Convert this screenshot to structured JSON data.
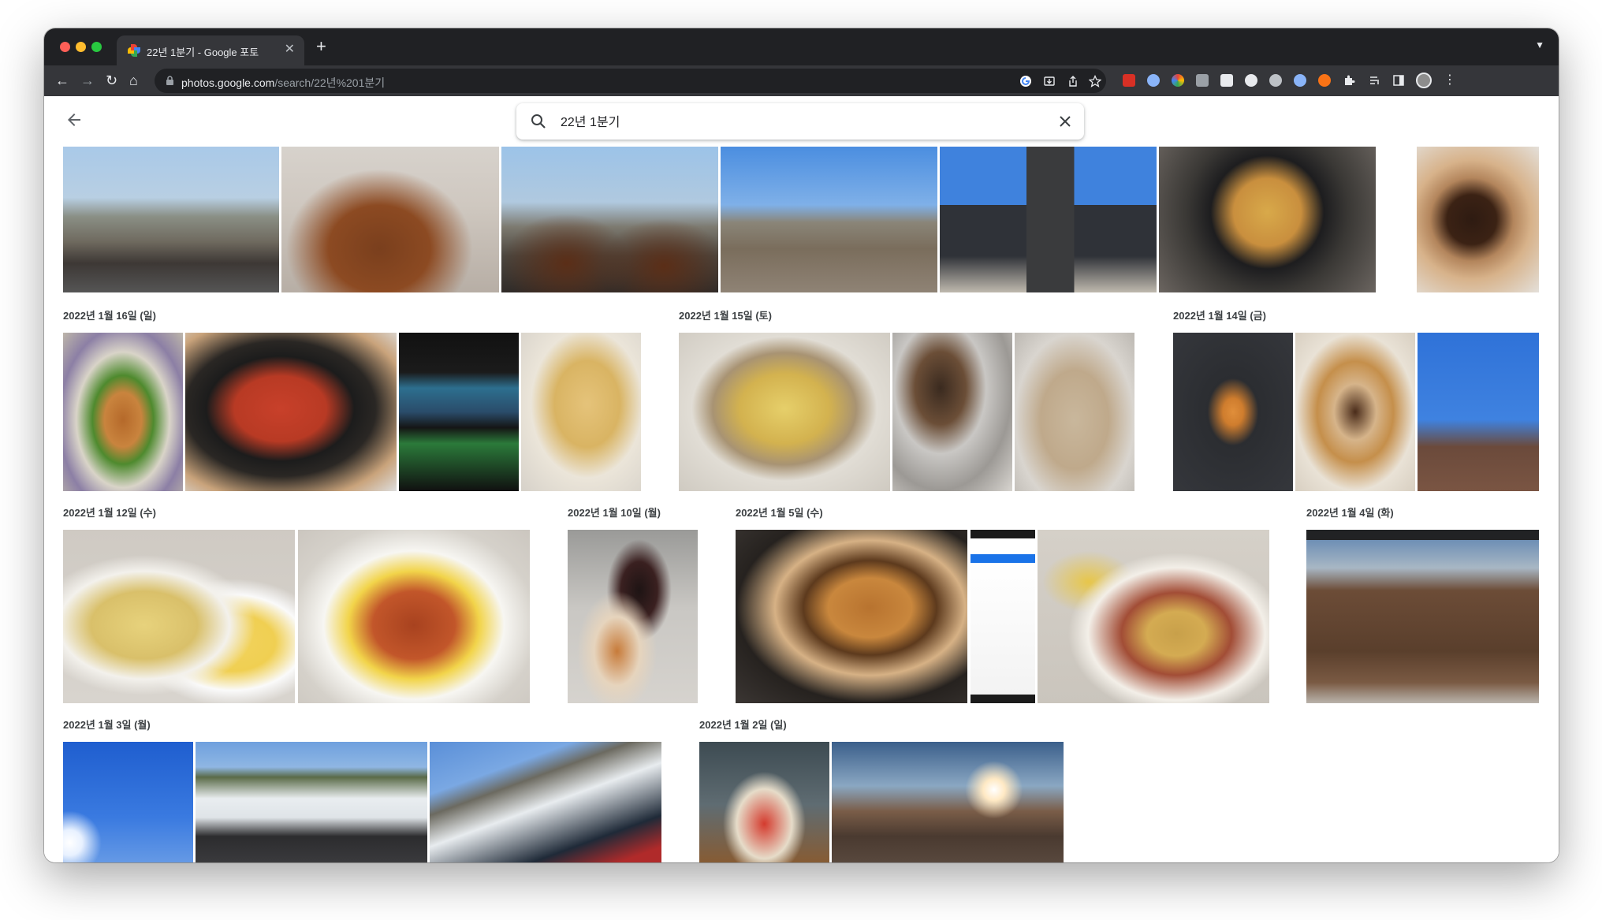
{
  "tab": {
    "title": "22년 1분기 - Google 포토"
  },
  "omnibox": {
    "host": "photos.google.com",
    "path": "/search/22년%201분기"
  },
  "search": {
    "query": "22년 1분기"
  },
  "dates": {
    "jan16": "2022년 1월 16일 (일)",
    "jan15": "2022년 1월 15일 (토)",
    "jan14": "2022년 1월 14일 (금)",
    "jan12": "2022년 1월 12일 (수)",
    "jan10": "2022년 1월 10일 (월)",
    "jan5": "2022년 1월 5일 (수)",
    "jan4": "2022년 1월 4일 (화)",
    "jan3": "2022년 1월 3일 (월)",
    "jan2": "2022년 1월 2일 (일)"
  },
  "colors": {
    "chrome_dark": "#202124",
    "toolbar": "#35363a",
    "date_text": "#3c4043"
  }
}
